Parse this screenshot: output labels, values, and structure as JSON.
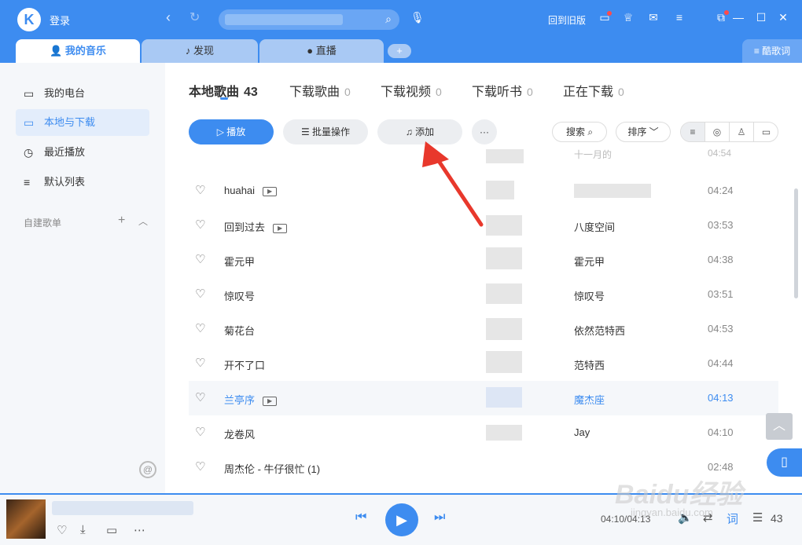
{
  "app": {
    "login": "登录",
    "logo_letter": "K",
    "old_version": "回到旧版"
  },
  "tabs": [
    {
      "label": "我的音乐",
      "icon": "person-icon"
    },
    {
      "label": "发现",
      "icon": "note-icon"
    },
    {
      "label": "直播",
      "icon": "live-icon"
    }
  ],
  "tab_add": "+",
  "lyric_button": "酷歌词",
  "sidebar": {
    "items": [
      {
        "label": "我的电台",
        "icon": "radio-icon"
      },
      {
        "label": "本地与下载",
        "icon": "monitor-icon"
      },
      {
        "label": "最近播放",
        "icon": "clock-icon"
      },
      {
        "label": "默认列表",
        "icon": "playlist-icon"
      }
    ],
    "section": "自建歌单"
  },
  "content_tabs": [
    {
      "label": "本地歌曲",
      "count": "43"
    },
    {
      "label": "下载歌曲",
      "count": "0"
    },
    {
      "label": "下载视频",
      "count": "0"
    },
    {
      "label": "下载听书",
      "count": "0"
    },
    {
      "label": "正在下载",
      "count": "0"
    }
  ],
  "toolbar": {
    "play": "播放",
    "batch": "批量操作",
    "add": "添加",
    "more": "···",
    "search": "搜索",
    "sort": "排序"
  },
  "songs": [
    {
      "name": "huahai",
      "mv": true,
      "artist": "",
      "duration": "04:24"
    },
    {
      "name": "回到过去",
      "mv": true,
      "artist": "八度空间",
      "duration": "03:53"
    },
    {
      "name": "霍元甲",
      "mv": false,
      "artist": "霍元甲",
      "duration": "04:38"
    },
    {
      "name": "惊叹号",
      "mv": false,
      "artist": "惊叹号",
      "duration": "03:51"
    },
    {
      "name": "菊花台",
      "mv": false,
      "artist": "依然范特西",
      "duration": "04:53"
    },
    {
      "name": "开不了口",
      "mv": false,
      "artist": "范特西",
      "duration": "04:44"
    },
    {
      "name": "兰亭序",
      "mv": true,
      "artist": "魔杰座",
      "duration": "04:13"
    },
    {
      "name": "龙卷风",
      "mv": false,
      "artist": "Jay",
      "duration": "04:10"
    },
    {
      "name": "周杰伦 - 牛仔很忙 (1)",
      "mv": false,
      "artist": "",
      "duration": "02:48"
    }
  ],
  "cutoff_row": {
    "artist": "十一月的",
    "duration": "04:54"
  },
  "player": {
    "time": "04:10/04:13",
    "lyric": "词",
    "count": "43"
  },
  "watermark": {
    "main": "Baidu经验",
    "sub": "jingyan.baidu.com"
  },
  "colors": {
    "accent": "#3d8cf0",
    "arrow": "#e8382c"
  }
}
